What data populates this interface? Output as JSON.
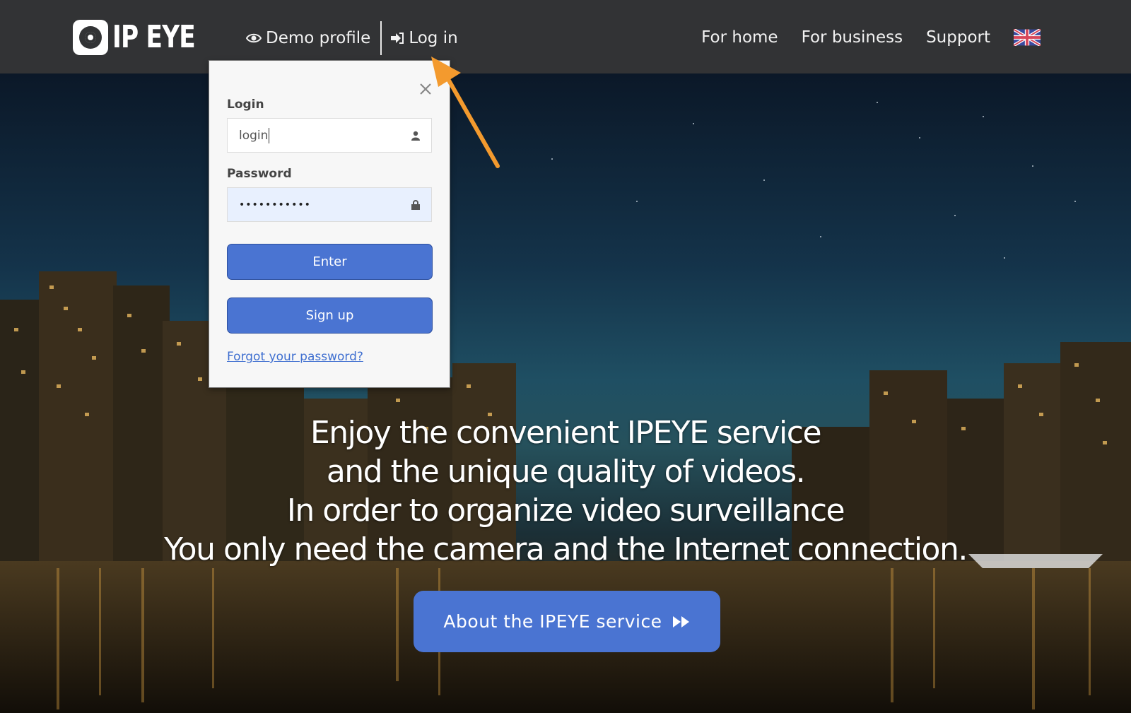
{
  "header": {
    "logo_text": "IP EYE",
    "nav_left": [
      {
        "label": "Demo profile",
        "icon": "eye-icon"
      },
      {
        "label": "Log in",
        "icon": "sign-in-icon"
      }
    ],
    "nav_right": [
      {
        "label": "For home"
      },
      {
        "label": "For business"
      },
      {
        "label": "Support"
      }
    ],
    "language_flag": "uk-flag-icon"
  },
  "login_panel": {
    "login_label": "Login",
    "login_value": "login",
    "password_label": "Password",
    "password_value": "•••••••••••",
    "enter_button": "Enter",
    "signup_button": "Sign up",
    "forgot_link": "Forgot your password?"
  },
  "hero": {
    "lines": [
      "Enjoy the convenient IPEYE service",
      "and the unique quality of videos.",
      "In order to organize video surveillance",
      "You only need the camera and the Internet connection."
    ],
    "cta_label": "About the IPEYE service"
  },
  "colors": {
    "topbar": "#323335",
    "accent_blue": "#4a74d2",
    "annotation_arrow": "#f39a2e"
  }
}
